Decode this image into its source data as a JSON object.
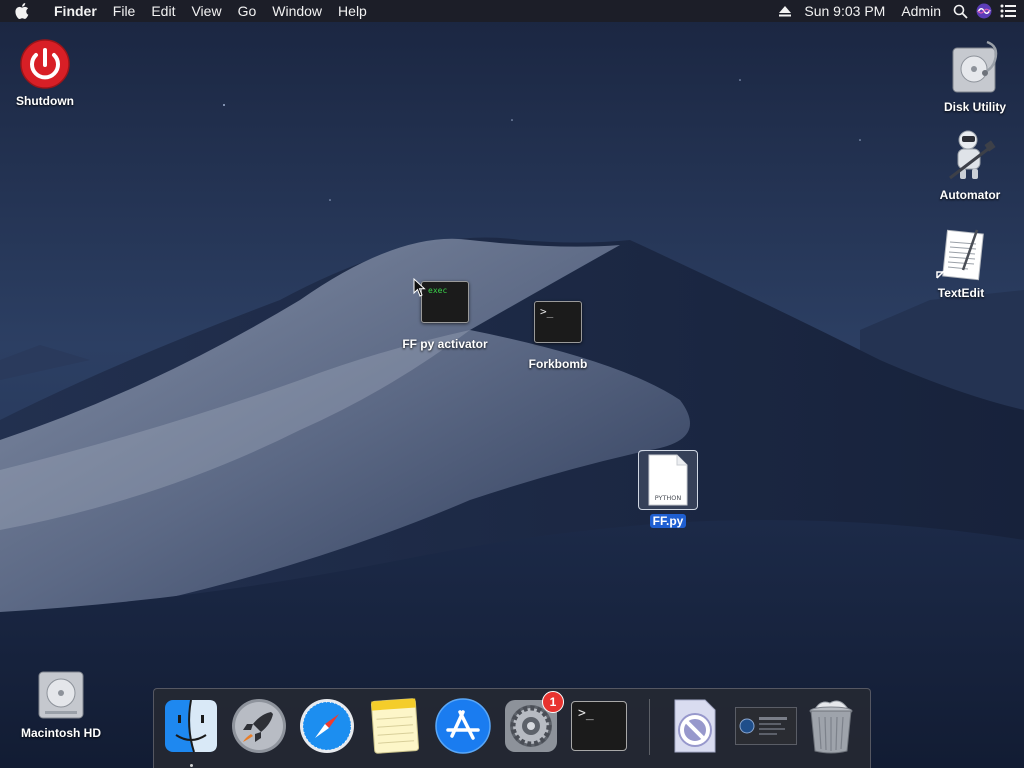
{
  "menubar": {
    "apple_icon": "apple-logo-icon",
    "app_name": "Finder",
    "menus": [
      "File",
      "Edit",
      "View",
      "Go",
      "Window",
      "Help"
    ],
    "clock": "Sun 9:03 PM",
    "user": "Admin",
    "status_icons": [
      "eject-icon",
      "spotlight-search-icon",
      "siri-icon",
      "notification-center-icon"
    ]
  },
  "desktop": {
    "icons": [
      {
        "label": "Shutdown",
        "icon": "power-button-icon"
      },
      {
        "label": "Disk Utility",
        "icon": "disk-utility-icon"
      },
      {
        "label": "Automator",
        "icon": "automator-robot-icon"
      },
      {
        "label": "TextEdit",
        "icon": "textedit-alias-icon"
      },
      {
        "label": "FF py activator",
        "icon": "exec-terminal-icon",
        "icon_text": "exec"
      },
      {
        "label": "Forkbomb",
        "icon": "terminal-script-icon",
        "icon_text": ">_"
      },
      {
        "label": "FF.py",
        "icon": "python-file-icon",
        "icon_text": "PYTHON",
        "selected": true
      },
      {
        "label": "Macintosh HD",
        "icon": "hard-drive-icon"
      }
    ]
  },
  "dock": {
    "items": [
      {
        "name": "Finder",
        "icon": "finder-icon",
        "running": true
      },
      {
        "name": "Launchpad",
        "icon": "launchpad-rocket-icon"
      },
      {
        "name": "Safari",
        "icon": "safari-compass-icon"
      },
      {
        "name": "Notes",
        "icon": "notes-icon"
      },
      {
        "name": "App Store",
        "icon": "app-store-icon"
      },
      {
        "name": "System Preferences",
        "icon": "system-preferences-gear-icon",
        "badge": "1"
      },
      {
        "name": "Terminal",
        "icon": "terminal-icon",
        "icon_text": ">_"
      },
      {
        "name": "Prohibited App",
        "icon": "prohibited-app-icon"
      },
      {
        "name": "Screen Thumbnail",
        "icon": "screenshot-thumbnail-icon"
      },
      {
        "name": "Trash",
        "icon": "trash-full-icon"
      }
    ]
  },
  "colors": {
    "menubar_bg": "#1c1e24",
    "selection_blue": "#1f5fd1",
    "power_red": "#d81f26",
    "badge_red": "#e8332f",
    "terminal_green": "#3ad24a"
  }
}
